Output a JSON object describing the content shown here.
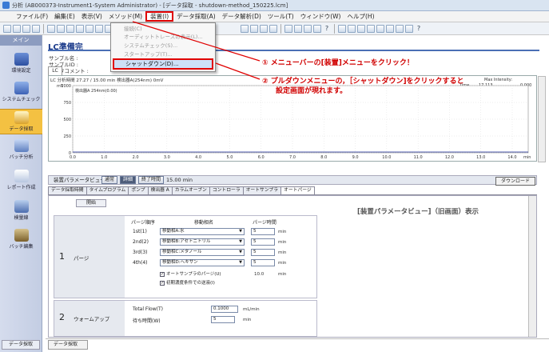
{
  "window": {
    "title": "分析 (AB000373-Instrument1-System Administrator) - [データ採取 - shutdown-method_150225.lcm]"
  },
  "menubar": {
    "items": [
      "ファイル(F)",
      "編集(E)",
      "表示(V)",
      "メソッド(M)",
      "装置(I)",
      "データ採取(A)",
      "データ解析(D)",
      "ツール(T)",
      "ウィンドウ(W)",
      "ヘルプ(H)"
    ],
    "highlighted": "装置(I)"
  },
  "dropdown": {
    "items": [
      "接続(C)",
      "オーディットトレースの表示(L)...",
      "システムチェック(S)...",
      "スタートアップ(T)..."
    ],
    "shutdown_label": "シャットダウン(D)..."
  },
  "sidebar": {
    "header": "メイン",
    "items": [
      "環境設定",
      "システムチェック",
      "データ採取",
      "バッチ分析",
      "レポート作成",
      "検量線",
      "バッチ編集"
    ],
    "selected": "データ採取",
    "bottom": "データ採取"
  },
  "main": {
    "title": "LC準備完",
    "sample_name_label": "サンプル名 :",
    "sample_id_label": "サンプルID :",
    "data_comment_label": "データコメント :",
    "chart_tab": "LC",
    "chart_header": "LC 分析時間 27.27 / 15.00 min 検出器A(254nm) 0mV",
    "chart_series": "検出器A 254nm(0.00)",
    "chart_max_label": "Max Intensity:",
    "chart_time_label": "Time",
    "chart_time_value": "17.113",
    "chart_intensity_value": "0.000",
    "x_ticks": [
      "0.0",
      "1.0",
      "2.0",
      "3.0",
      "4.0",
      "5.0",
      "6.0",
      "7.0",
      "8.0",
      "9.0",
      "10.0",
      "11.0",
      "12.0",
      "13.0",
      "14.0"
    ],
    "y_ticks": [
      "1000",
      "750",
      "500",
      "250",
      "0"
    ],
    "y_unit": "mV",
    "x_unit": "min"
  },
  "callouts": {
    "step1": "① メニューバーの[装置]メニューをクリック！",
    "step2_line1": "② プルダウンメニューの，［シャットダウン]をクリックすると",
    "step2_line2": "設定画面が現れます。"
  },
  "param_view": {
    "header": "装置パラメータビュー",
    "btn_normal": "通常",
    "btn_detail": "詳細",
    "end_time_label": "終了時間",
    "end_time_value": "15.00 min",
    "download": "ダウンロード",
    "tabs": [
      "データ採取時間",
      "タイムプログラム",
      "ポンプ",
      "検出器 A",
      "カラムオーブン",
      "コントローラ",
      "オートサンプラ",
      "オートパージ"
    ],
    "selected_tab": "オートパージ",
    "old_view_label": "[装置パラメータビュー]（旧画面）表示",
    "start_label": "開始",
    "purge": {
      "num": "1",
      "name": "パージ",
      "col_order": "パージ順序",
      "col_solvent": "移動相名",
      "col_time": "パージ時間",
      "rows": [
        {
          "order": "1st(1)",
          "solvent": "移動相A:水",
          "time": "5",
          "unit": "min"
        },
        {
          "order": "2nd(2)",
          "solvent": "移動相B:アセトニトリル",
          "time": "5",
          "unit": "min"
        },
        {
          "order": "3rd(3)",
          "solvent": "移動相C:メタノール",
          "time": "5",
          "unit": "min"
        },
        {
          "order": "4th(4)",
          "solvent": "移動相D:ヘキサン",
          "time": "5",
          "unit": "min"
        }
      ],
      "check1": "オートサンプラのパージ(U)",
      "check1_value": "10.0",
      "check1_unit": "min",
      "check2": "初期濃度条件での送液(I)"
    },
    "warmup": {
      "num": "2",
      "name": "ウォームアップ",
      "flow_label": "Total Flow(T)",
      "flow_value": "0.1000",
      "flow_unit": "mL/min",
      "wait_label": "待ち時間(W)",
      "wait_value": "5",
      "wait_unit": "min"
    }
  },
  "bottom_tab": "データ採取",
  "colors": {
    "highlight_red": "#e00000",
    "title_blue": "#1a3a8a",
    "selected_sidebar": "#f4c142"
  }
}
